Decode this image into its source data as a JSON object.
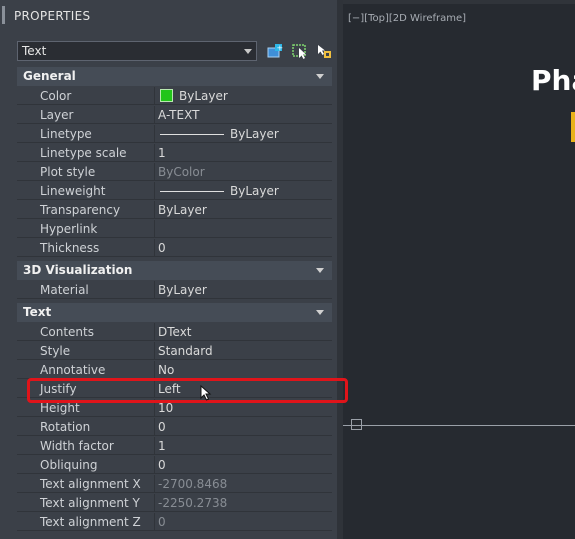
{
  "palette": {
    "title": "PROPERTIES",
    "selector_value": "Text",
    "toolbar_icons": [
      "toggle-pickadd-icon",
      "select-objects-icon",
      "quick-select-icon"
    ]
  },
  "sections": {
    "general": {
      "title": "General",
      "rows": [
        {
          "name": "Color",
          "value": "ByLayer",
          "swatch_color": "#22c51a"
        },
        {
          "name": "Layer",
          "value": "A-TEXT"
        },
        {
          "name": "Linetype",
          "value": "ByLayer"
        },
        {
          "name": "Linetype scale",
          "value": "1"
        },
        {
          "name": "Plot style",
          "value": "ByColor"
        },
        {
          "name": "Lineweight",
          "value": "ByLayer"
        },
        {
          "name": "Transparency",
          "value": "ByLayer"
        },
        {
          "name": "Hyperlink",
          "value": ""
        },
        {
          "name": "Thickness",
          "value": "0"
        }
      ]
    },
    "viz3d": {
      "title": "3D Visualization",
      "rows": [
        {
          "name": "Material",
          "value": "ByLayer"
        }
      ]
    },
    "text": {
      "title": "Text",
      "rows": [
        {
          "name": "Contents",
          "value": "DText"
        },
        {
          "name": "Style",
          "value": "Standard"
        },
        {
          "name": "Annotative",
          "value": "No"
        },
        {
          "name": "Justify",
          "value": "Left"
        },
        {
          "name": "Height",
          "value": "10"
        },
        {
          "name": "Rotation",
          "value": "0"
        },
        {
          "name": "Width factor",
          "value": "1"
        },
        {
          "name": "Obliquing",
          "value": "0"
        },
        {
          "name": "Text alignment X",
          "value": "-2700.8468"
        },
        {
          "name": "Text alignment Y",
          "value": "-2250.2738"
        },
        {
          "name": "Text alignment Z",
          "value": "0"
        }
      ]
    }
  },
  "highlight_color": "#e0141a",
  "viewport": {
    "label": "[−][Top][2D Wireframe]",
    "visible_text": "Phâ"
  }
}
